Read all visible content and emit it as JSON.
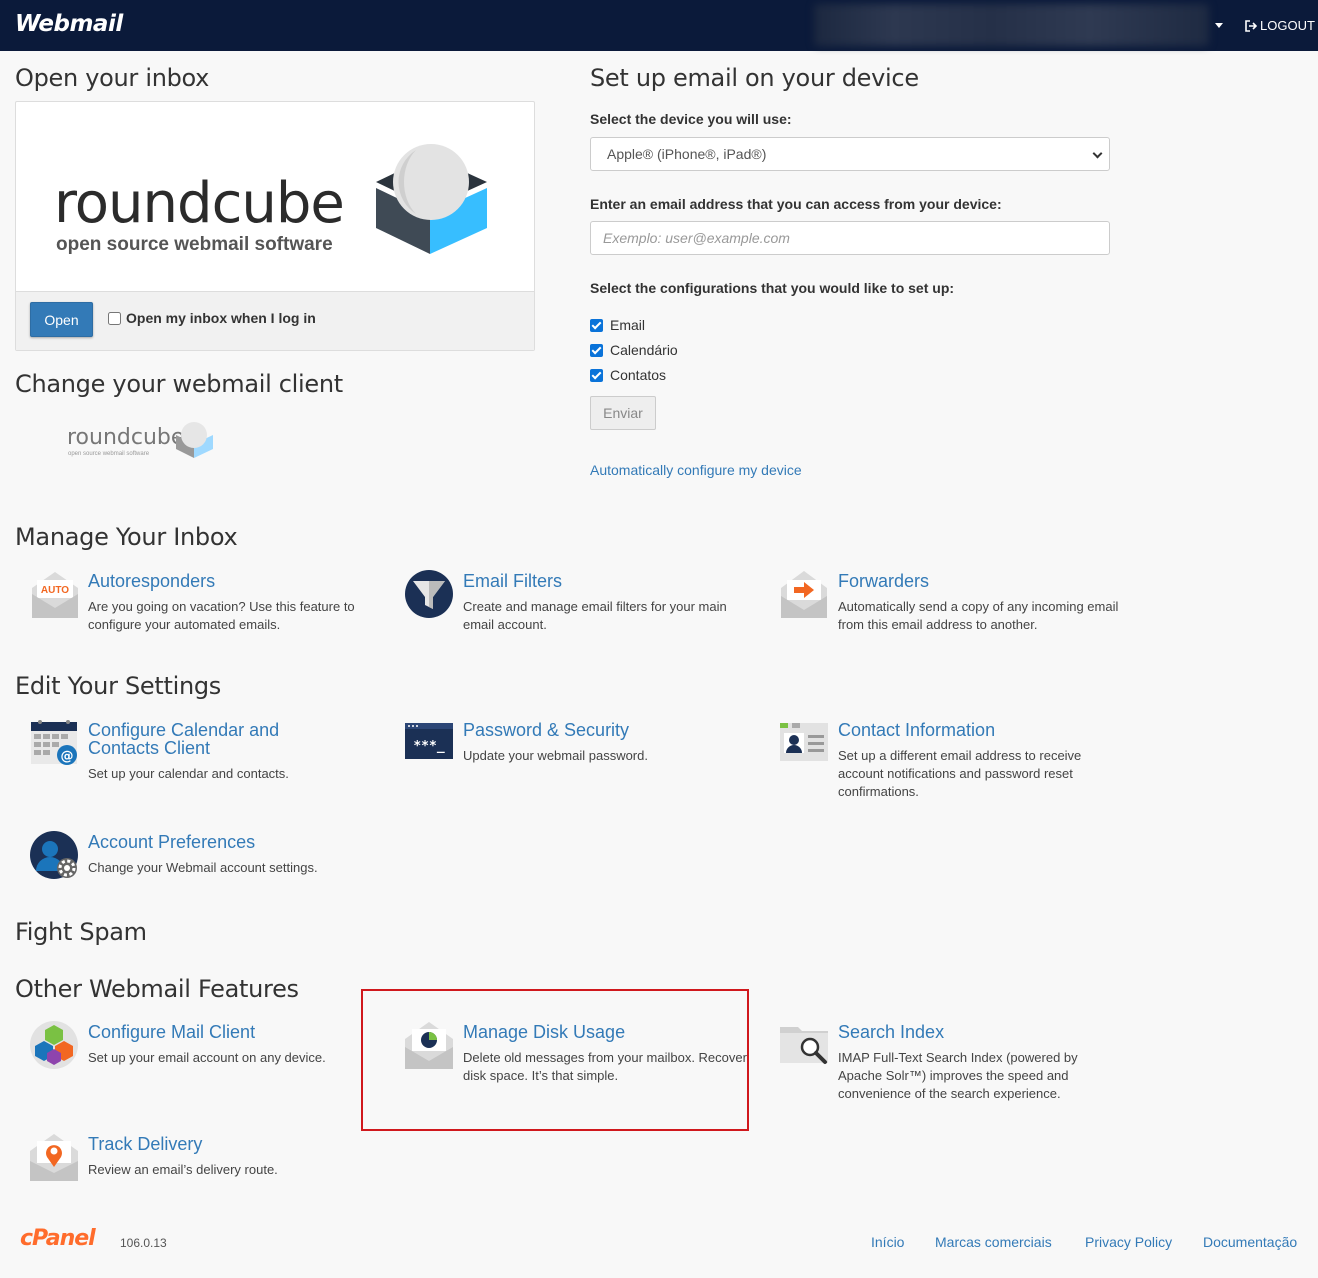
{
  "header": {
    "brand": "Webmail",
    "logout_label": "LOGOUT"
  },
  "inbox": {
    "title": "Open your inbox",
    "logo_word": "roundcube",
    "logo_tagline": "open source webmail software",
    "open_button": "Open",
    "auto_open_label": "Open my inbox when I log in"
  },
  "client": {
    "title": "Change your webmail client",
    "logo_word": "roundcube",
    "logo_tagline": "open source webmail software"
  },
  "device": {
    "title": "Set up email on your device",
    "device_label": "Select the device you will use:",
    "device_selected": "Apple® (iPhone®, iPad®)",
    "email_label": "Enter an email address that you can access from your device:",
    "email_placeholder": "Exemplo: user@example.com",
    "config_label": "Select the configurations that you would like to set up:",
    "configs": [
      "Email",
      "Calendário",
      "Contatos"
    ],
    "send_button": "Enviar",
    "auto_link": "Automatically configure my device"
  },
  "manage": {
    "title": "Manage Your Inbox",
    "items": [
      {
        "title": "Autoresponders",
        "desc": "Are you going on vacation? Use this feature to configure your automated emails.",
        "icon": "autoresponder-icon",
        "badge": "AUTO"
      },
      {
        "title": "Email Filters",
        "desc": "Create and manage email filters for your main email account.",
        "icon": "funnel-icon"
      },
      {
        "title": "Forwarders",
        "desc": "Automatically send a copy of any incoming email from this email address to another.",
        "icon": "forward-envelope-icon"
      }
    ]
  },
  "settings": {
    "title": "Edit Your Settings",
    "items": [
      {
        "title": "Configure Calendar and Contacts Client",
        "desc": "Set up your calendar and contacts.",
        "icon": "calendar-at-icon"
      },
      {
        "title": "Password & Security",
        "desc": "Update your webmail password.",
        "icon": "password-icon",
        "mask": "***_"
      },
      {
        "title": "Contact Information",
        "desc": "Set up a different email address to receive account notifications and password reset confirmations.",
        "icon": "contact-card-icon"
      },
      {
        "title": "Account Preferences",
        "desc": "Change your Webmail account settings.",
        "icon": "user-gear-icon"
      }
    ]
  },
  "spam": {
    "title": "Fight Spam"
  },
  "other": {
    "title": "Other Webmail Features",
    "items": [
      {
        "title": "Configure Mail Client",
        "desc": "Set up your email account on any device.",
        "icon": "cubes-icon"
      },
      {
        "title": "Manage Disk Usage",
        "desc": "Delete old messages from your mailbox. Recover disk space. It’s that simple.",
        "icon": "disk-usage-envelope-icon"
      },
      {
        "title": "Search Index",
        "desc": "IMAP Full-Text Search Index (powered by Apache Solr™) improves the speed and convenience of the search experience.",
        "icon": "folder-search-icon"
      },
      {
        "title": "Track Delivery",
        "desc": "Review an email’s delivery route.",
        "icon": "track-delivery-icon"
      }
    ]
  },
  "footer": {
    "logo": "cPanel",
    "version": "106.0.13",
    "links": [
      "Início",
      "Marcas comerciais",
      "Privacy Policy",
      "Documentação"
    ]
  },
  "colors": {
    "header_bg": "#0b1a3a",
    "link": "#337ab7",
    "primary_button": "#337ab7",
    "highlight_border": "#d0181d",
    "cpanel_orange": "#ff6c2c",
    "roundcube_blue": "#37beff"
  }
}
